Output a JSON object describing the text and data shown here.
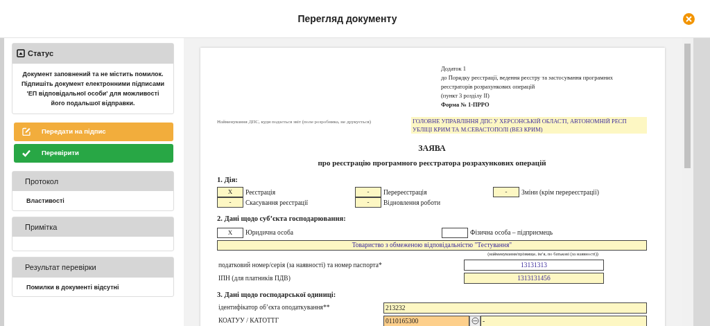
{
  "window": {
    "title": "Перегляд документу"
  },
  "sidebar": {
    "status": {
      "title": "Статус",
      "message": "Документ заповнений та не містить помилок. Підпишіть документ електронними підписами 'ЕП відповідальної особи' для можливості його подальшої відправки."
    },
    "buttons": [
      {
        "label": "Передати на підпис",
        "kind": "sign"
      },
      {
        "label": "Перевірити",
        "kind": "check"
      }
    ],
    "panels": [
      {
        "title": "Протокол",
        "body": "Властивості"
      },
      {
        "title": "Примітка"
      },
      {
        "title": "Результат перевірки",
        "body": "Помилки в документі відсутні"
      }
    ]
  },
  "document": {
    "header_lines": [
      "Додаток 1",
      "до Порядку реєстрації, ведення реєстру та застосування програмних",
      "реєстраторів розрахункових операцій",
      "(пункт 3 розділу ІІ)"
    ],
    "form_name": "Форма № 1-ПРРО",
    "dps_label": "Найменування ДПС, куди подається звіт (поле розробника, не друкується)",
    "dps_value": "ГОЛОВНЕ УПРАВЛІННЯ ДПС У ХЕРСОНСЬКІЙ ОБЛАСТІ, АВТОНОМНІЙ РЕСП УБЛІЦІ КРИМ ТА М.СЕВАСТОПОЛІ (ВЕЗ КРИМ)",
    "heading": "ЗАЯВА",
    "subheading": "про реєстрацію програмного реєстратора розрахункових операцій",
    "section_1": {
      "title": "1. Дія:",
      "options": [
        {
          "mark": "Х",
          "label": "Реєстрація",
          "highlighted": true
        },
        {
          "mark": "-",
          "label": "Перереєстрація",
          "highlighted": true
        },
        {
          "mark": "-",
          "label": "Зміни (крім перереєстрації)",
          "highlighted": true
        },
        {
          "mark": "-",
          "label": "Скасування реєстрації",
          "highlighted": true
        },
        {
          "mark": "-",
          "label": "Відновлення роботи",
          "highlighted": true
        }
      ]
    },
    "section_2": {
      "title": "2. Дані щодо суб’єкта господарювання:",
      "options": [
        {
          "mark": "Х",
          "label": "Юридична особа",
          "highlighted": false
        },
        {
          "label": "Фізична особа – підприємець",
          "highlighted": false
        }
      ],
      "name_value": "Товариство з обмеженою відповідальністю \"Тестування\"",
      "name_caption": "(найменування/прізвище, ім’я, по батькові (за наявності))",
      "fields": [
        {
          "label": "податковий номер/серія (за наявності) та номер паспорта*",
          "value": "13131313",
          "highlighted": false
        },
        {
          "label": "ІПН (для платників ПДВ)",
          "value": "1313131456",
          "highlighted": true
        }
      ]
    },
    "section_3": {
      "title": "3. Дані щодо господарської одиниці:",
      "fields": [
        {
          "kind": "text",
          "label": "ідентифікатор об’єкта оподаткування**",
          "value": "213232"
        },
        {
          "kind": "lookup",
          "label": "КОАТУУ / КАТОТТГ",
          "value": "0110165300",
          "extra": "-"
        }
      ]
    }
  }
}
